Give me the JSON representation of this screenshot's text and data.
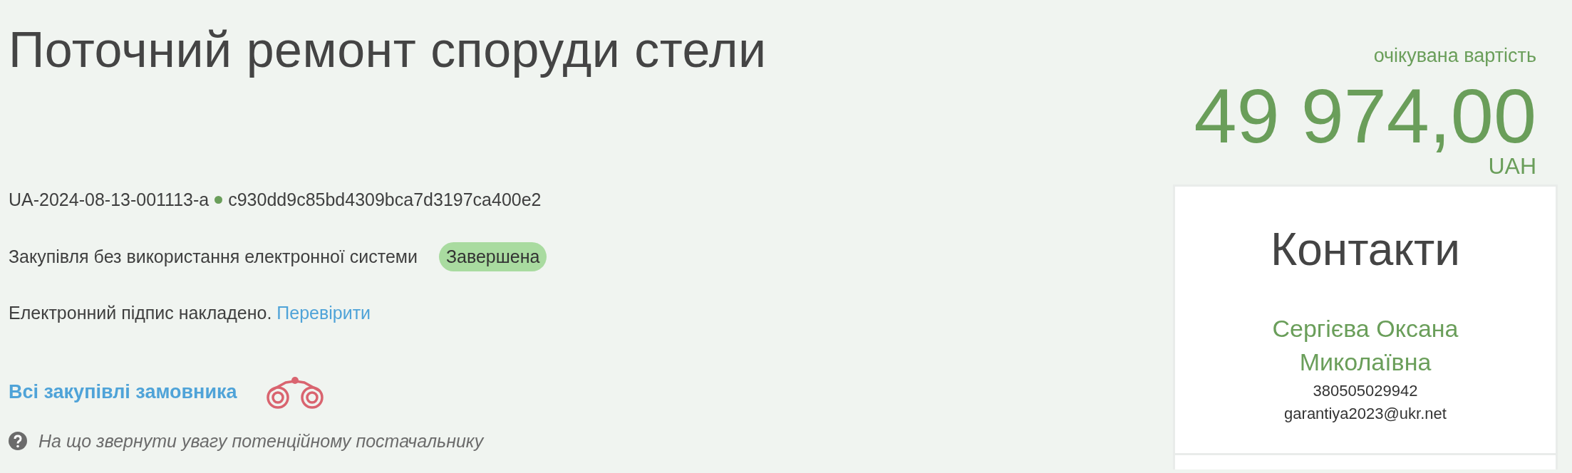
{
  "title": "Поточний ремонт споруди стели",
  "tender": {
    "id": "UA-2024-08-13-001113-a",
    "hash": "c930dd9c85bd4309bca7d3197ca400e2"
  },
  "procurement": {
    "type": "Закупівля без використання електронної системи",
    "status": {
      "label": "Завершена",
      "kind": "complete"
    }
  },
  "signature": {
    "text": "Електронний підпис накладено.",
    "link": "Перевірити"
  },
  "buyer_link": "Всі закупівлі замовника",
  "hint": "На що звернути увагу потенційному постачальнику",
  "expected_value": {
    "label": "очікувана вартість",
    "amount": "49 974,00",
    "currency": "UAH"
  },
  "contacts": {
    "title": "Контакти",
    "name": "Сергієва Оксана Миколаївна",
    "phone": "380505029942",
    "email": "garantiya2023@ukr.net"
  }
}
